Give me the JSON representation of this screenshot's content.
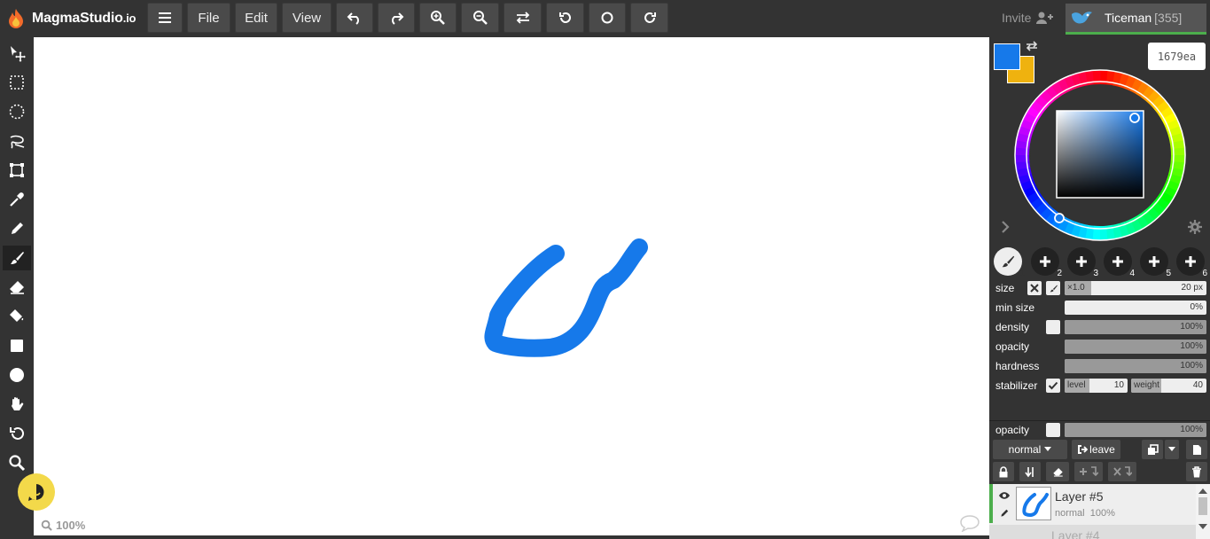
{
  "app": {
    "name": "MagmaStudio",
    "suffix": ".io"
  },
  "menu": {
    "file": "File",
    "edit": "Edit",
    "view": "View"
  },
  "header": {
    "invite": "Invite",
    "user_name": "Ticeman",
    "user_count": "[355]"
  },
  "colors": {
    "primary": "#1679ea",
    "secondary": "#efb20f",
    "hex_value": "1679ea",
    "accent_green": "#4cae4c"
  },
  "canvas": {
    "zoom": "100%"
  },
  "brush_slots": [
    "1",
    "2",
    "3",
    "4",
    "5",
    "6"
  ],
  "brush": {
    "size_label": "size",
    "size_multiplier": "×1.0",
    "size_value": "20 px",
    "min_size_label": "min size",
    "min_size_value": "0%",
    "density_label": "density",
    "density_value": "100%",
    "opacity_label": "opacity",
    "opacity_value": "100%",
    "hardness_label": "hardness",
    "hardness_value": "100%",
    "stabilizer_label": "stabilizer",
    "level_label": "level",
    "level_value": "10",
    "weight_label": "weight",
    "weight_value": "40"
  },
  "layer_opacity": {
    "label": "opacity",
    "value": "100%"
  },
  "layer_controls": {
    "blend_mode": "normal",
    "leave_label": "leave"
  },
  "layers": [
    {
      "name": "Layer #5",
      "mode": "normal",
      "opacity": "100%"
    },
    {
      "name": "Layer #4"
    }
  ]
}
